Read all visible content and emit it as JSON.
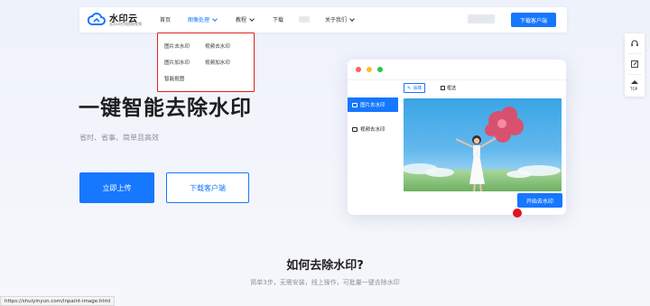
{
  "brand": {
    "name": "水印云",
    "slogan": "去水印在线提取视频"
  },
  "nav": {
    "items": [
      {
        "label": "首页"
      },
      {
        "label": "图像处理",
        "active": true,
        "has_caret": true
      },
      {
        "label": "教程",
        "has_caret": true
      },
      {
        "label": "下载"
      },
      {
        "label": "关于我们",
        "has_caret": true
      }
    ],
    "download_label": "下载客户端"
  },
  "dropdown": {
    "items": [
      "图片去水印",
      "视频去水印",
      "图片加水印",
      "视频加水印",
      "智能抠图"
    ]
  },
  "hero": {
    "title": "一键智能去除水印",
    "subtitle": "省时、省事、简单且高效",
    "primary_button": "立即上传",
    "secondary_button": "下载客户端"
  },
  "mockup": {
    "window_dots": [
      "#ff5f57",
      "#febc2e",
      "#28c840"
    ],
    "sidebar": [
      "图片去水印",
      "视频去水印"
    ],
    "toolbar": [
      "涂抹",
      "框选"
    ],
    "start_button": "开始去水印"
  },
  "float_bar": {
    "top_label": "TOP"
  },
  "section": {
    "title": "如何去除水印?",
    "subtitle": "简单3步，无需安装，线上操作，可批量一键去除水印"
  },
  "status_bar": {
    "url": "https://shuiyinyun.com/inpaint-image.html"
  },
  "colors": {
    "accent": "#1677ff",
    "highlight_border": "#e02020",
    "text": "#1d1d1f",
    "muted": "#8a8f99"
  }
}
